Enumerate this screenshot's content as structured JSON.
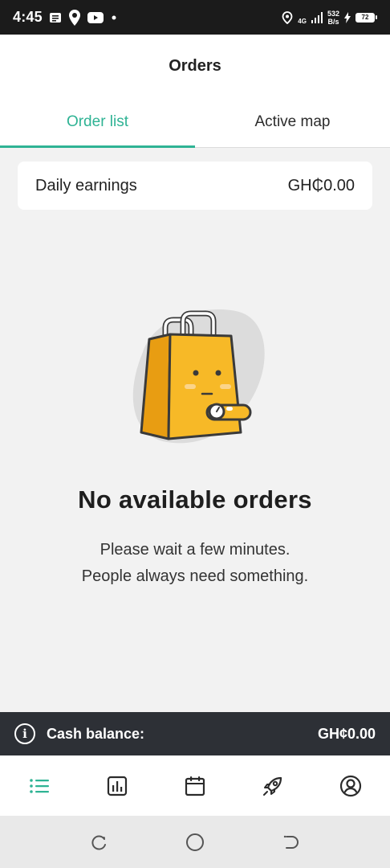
{
  "status_bar": {
    "time": "4:45",
    "network_type": "4G",
    "net_speed_value": "532",
    "net_speed_unit": "B/s",
    "battery_level": "72"
  },
  "header": {
    "title": "Orders"
  },
  "tabs": [
    {
      "label": "Order list",
      "active": true
    },
    {
      "label": "Active map",
      "active": false
    }
  ],
  "earnings": {
    "label": "Daily earnings",
    "value": "GH₵0.00"
  },
  "empty_state": {
    "title": "No available orders",
    "line1": "Please wait a few minutes.",
    "line2": "People always need something."
  },
  "cash_balance": {
    "label": "Cash balance:",
    "value": "GH¢0.00"
  },
  "bottom_nav": [
    {
      "icon": "list-icon",
      "active": true
    },
    {
      "icon": "bar-chart-icon",
      "active": false
    },
    {
      "icon": "calendar-icon",
      "active": false
    },
    {
      "icon": "rocket-icon",
      "active": false
    },
    {
      "icon": "profile-icon",
      "active": false
    }
  ],
  "colors": {
    "accent": "#2fb394",
    "status_bar_bg": "#1b1b1b",
    "cash_bar_bg": "#2d3036",
    "page_bg": "#f2f2f2",
    "bag_yellow": "#f7b927"
  }
}
